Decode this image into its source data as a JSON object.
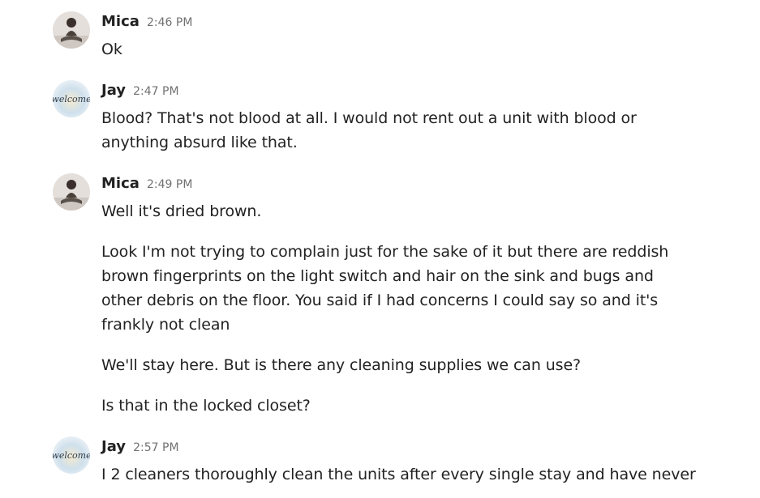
{
  "messages": [
    {
      "sender": "Mica",
      "time": "2:46 PM",
      "avatar": "mica-avatar",
      "paragraphs": [
        "Ok"
      ]
    },
    {
      "sender": "Jay",
      "time": "2:47 PM",
      "avatar": "jay-welcome-avatar",
      "avatar_text": "welcome",
      "paragraphs": [
        "Blood? That's not blood at all. I would not rent out a unit with blood or anything absurd like that."
      ]
    },
    {
      "sender": "Mica",
      "time": "2:49 PM",
      "avatar": "mica-avatar",
      "paragraphs": [
        "Well it's dried brown.",
        "Look I'm not trying to complain just for the sake of it but there are reddish brown fingerprints on the light switch and hair on the sink and bugs and other debris on the floor. You said if I had concerns I could say so and it's frankly not clean",
        "We'll stay here. But is there any cleaning supplies we can use?",
        "Is that in the locked closet?"
      ]
    },
    {
      "sender": "Jay",
      "time": "2:57 PM",
      "avatar": "jay-welcome-avatar",
      "avatar_text": "welcome",
      "paragraphs": [
        "I 2 cleaners thoroughly clean the units after every single stay and have never"
      ]
    }
  ],
  "colors": {
    "text": "#222222",
    "timestamp": "#717171",
    "background": "#ffffff"
  }
}
